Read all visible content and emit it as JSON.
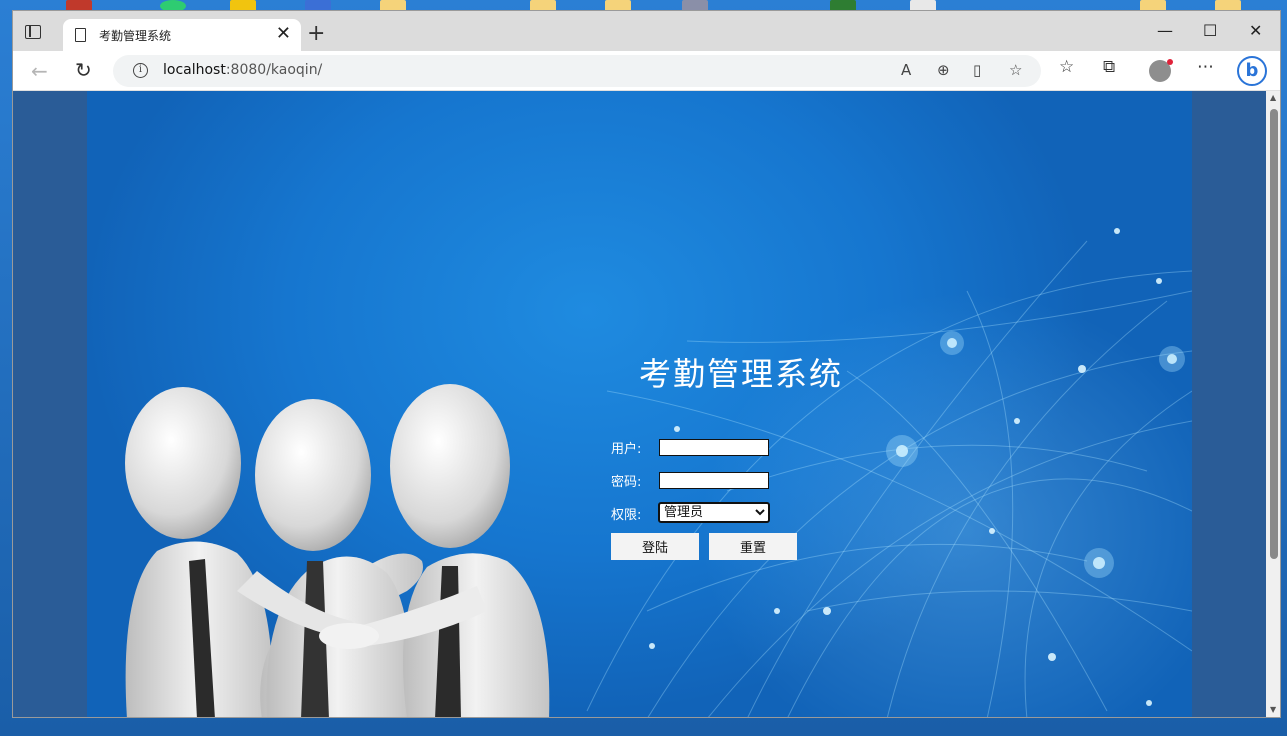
{
  "browser": {
    "tab_title": "考勤管理系统",
    "url_host": "localhost",
    "url_rest": ":8080/kaoqin/",
    "new_tab_glyph": "+",
    "close_tab_glyph": "✕",
    "minimize_glyph": "—",
    "maximize_glyph": "☐",
    "close_window_glyph": "✕",
    "icons": [
      "tab-actions-icon",
      "page-icon",
      "back-icon",
      "reload-icon",
      "info-icon",
      "read-aloud-icon",
      "zoom-icon",
      "split-screen-icon",
      "add-favorite-icon",
      "favorites-icon",
      "collections-icon",
      "profile-icon",
      "more-icon",
      "bing-icon"
    ]
  },
  "login": {
    "title": "考勤管理系统",
    "username_label": "用户:",
    "password_label": "密码:",
    "role_label": "权限:",
    "role_options": [
      "管理员"
    ],
    "role_selected": "管理员",
    "login_button": "登陆",
    "reset_button": "重置"
  },
  "colors": {
    "hero_blue": "#1676cf",
    "page_side": "#2a5c97",
    "bing_blue": "#2a74d8"
  }
}
